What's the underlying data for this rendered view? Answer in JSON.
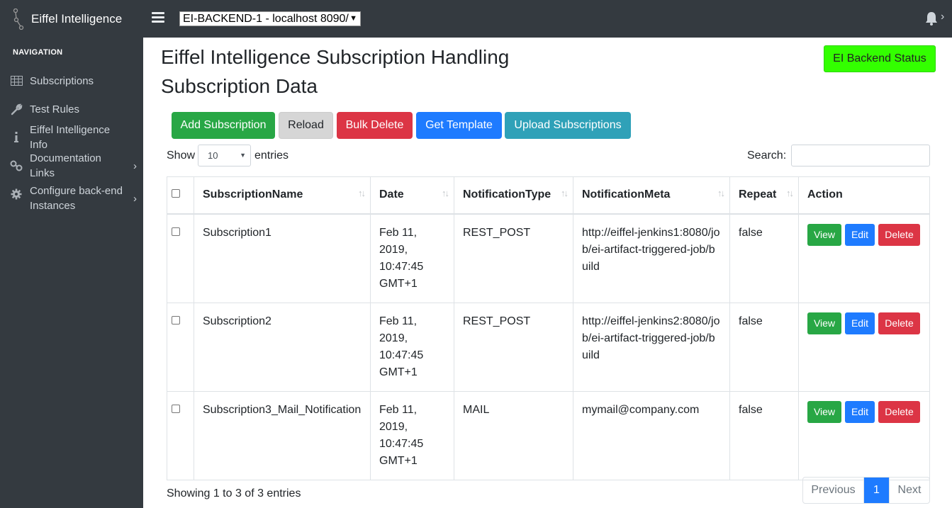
{
  "app": {
    "brand": "Eiffel Intelligence",
    "backend_selector": "EI-BACKEND-1 - localhost 8090/"
  },
  "sidebar": {
    "heading": "NAVIGATION",
    "items": [
      {
        "label": "Subscriptions",
        "icon": "table-icon"
      },
      {
        "label": "Test Rules",
        "icon": "wrench-icon"
      },
      {
        "label": "Eiffel Intelligence Info",
        "icon": "info-icon"
      },
      {
        "label": "Documentation Links",
        "icon": "link-icon"
      },
      {
        "label": "Configure back-end Instances",
        "icon": "gear-icon"
      }
    ]
  },
  "main": {
    "title": "Eiffel Intelligence Subscription Handling",
    "subtitle": "Subscription Data",
    "status_button": "EI Backend Status",
    "toolbar": {
      "add": "Add Subscription",
      "reload": "Reload",
      "bulk_delete": "Bulk Delete",
      "get_template": "Get Template",
      "upload": "Upload Subscriptions"
    },
    "length": {
      "show": "Show",
      "value": "10",
      "entries": "entries"
    },
    "search": {
      "label": "Search:",
      "value": ""
    },
    "table": {
      "headers": [
        "SubscriptionName",
        "Date",
        "NotificationType",
        "NotificationMeta",
        "Repeat",
        "Action"
      ],
      "rows": [
        {
          "name": "Subscription1",
          "date": "Feb 11, 2019, 10:47:45 GMT+1",
          "type": "REST_POST",
          "meta": "http://eiffel-jenkins1:8080/job/ei-artifact-triggered-job/build",
          "repeat": "false"
        },
        {
          "name": "Subscription2",
          "date": "Feb 11, 2019, 10:47:45 GMT+1",
          "type": "REST_POST",
          "meta": "http://eiffel-jenkins2:8080/job/ei-artifact-triggered-job/build",
          "repeat": "false"
        },
        {
          "name": "Subscription3_Mail_Notification",
          "date": "Feb 11, 2019, 10:47:45 GMT+1",
          "type": "MAIL",
          "meta": "mymail@company.com",
          "repeat": "false"
        }
      ],
      "actions": {
        "view": "View",
        "edit": "Edit",
        "delete": "Delete"
      }
    },
    "info": "Showing 1 to 3 of 3 entries",
    "pagination": {
      "previous": "Previous",
      "current": "1",
      "next": "Next"
    }
  },
  "colors": {
    "sidebar_bg": "#343a40",
    "status_green": "#33ff00",
    "primary": "#1e7bff",
    "success": "#28a745",
    "danger": "#dc3545",
    "info": "#2fa1b8"
  }
}
